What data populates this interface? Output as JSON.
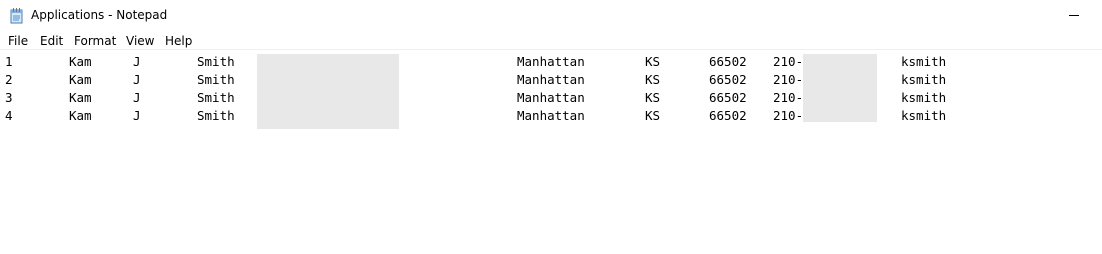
{
  "window": {
    "title": "Applications - Notepad",
    "icon": "notepad-icon",
    "controls": [
      "minimize-icon"
    ]
  },
  "menu": {
    "file": "File",
    "edit": "Edit",
    "format": "Format",
    "view": "View",
    "help": "Help"
  },
  "document": {
    "rows": [
      {
        "num": "1",
        "first": "Kam",
        "middle": "J",
        "last": "Smith",
        "city": "Manhattan",
        "state": "KS",
        "zip": "66502",
        "phone_prefix": "210-",
        "username": "ksmith"
      },
      {
        "num": "2",
        "first": "Kam",
        "middle": "J",
        "last": "Smith",
        "city": "Manhattan",
        "state": "KS",
        "zip": "66502",
        "phone_prefix": "210-",
        "username": "ksmith"
      },
      {
        "num": "3",
        "first": "Kam",
        "middle": "J",
        "last": "Smith",
        "city": "Manhattan",
        "state": "KS",
        "zip": "66502",
        "phone_prefix": "210-",
        "username": "ksmith"
      },
      {
        "num": "4",
        "first": "Kam",
        "middle": "J",
        "last": "Smith",
        "city": "Manhattan",
        "state": "KS",
        "zip": "66502",
        "phone_prefix": "210-",
        "username": "ksmith"
      }
    ]
  },
  "colors": {
    "redaction": "#e8e8e8",
    "background": "#ffffff"
  }
}
